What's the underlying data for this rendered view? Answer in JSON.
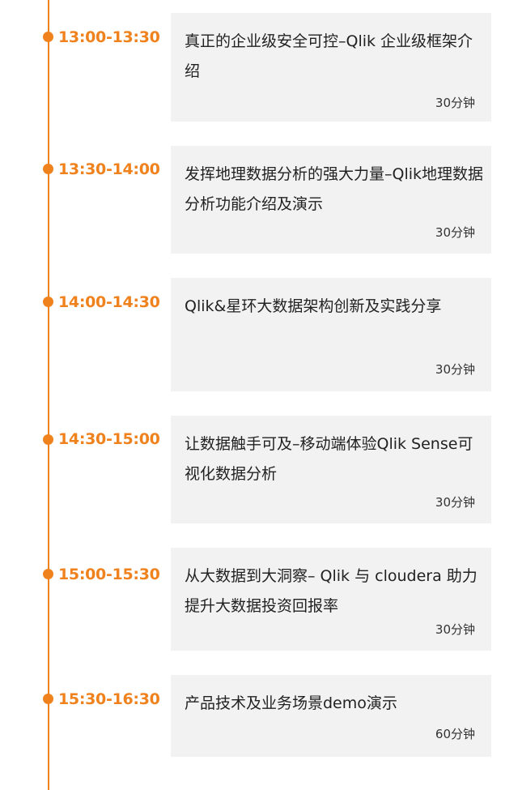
{
  "colors": {
    "accent": "#f0821e",
    "card_background": "#f2f2f2",
    "title_text": "#222222"
  },
  "schedule": [
    {
      "time": "13:00-13:30",
      "title": "真正的企业级安全可控–Qlik 企业级框架介绍",
      "duration": "30分钟"
    },
    {
      "time": "13:30-14:00",
      "title": "发挥地理数据分析的强大力量–Qlik地理数据分析功能介绍及演示",
      "duration": "30分钟"
    },
    {
      "time": "14:00-14:30",
      "title": "Qlik&星环大数据架构创新及实践分享",
      "duration": "30分钟"
    },
    {
      "time": "14:30-15:00",
      "title": "让数据触手可及–移动端体验Qlik Sense可视化数据分析",
      "duration": "30分钟"
    },
    {
      "time": "15:00-15:30",
      "title": "从大数据到大洞察– Qlik 与 cloudera 助力提升大数据投资回报率",
      "duration": "30分钟"
    },
    {
      "time": "15:30-16:30",
      "title": "产品技术及业务场景demo演示",
      "duration": "60分钟"
    }
  ]
}
